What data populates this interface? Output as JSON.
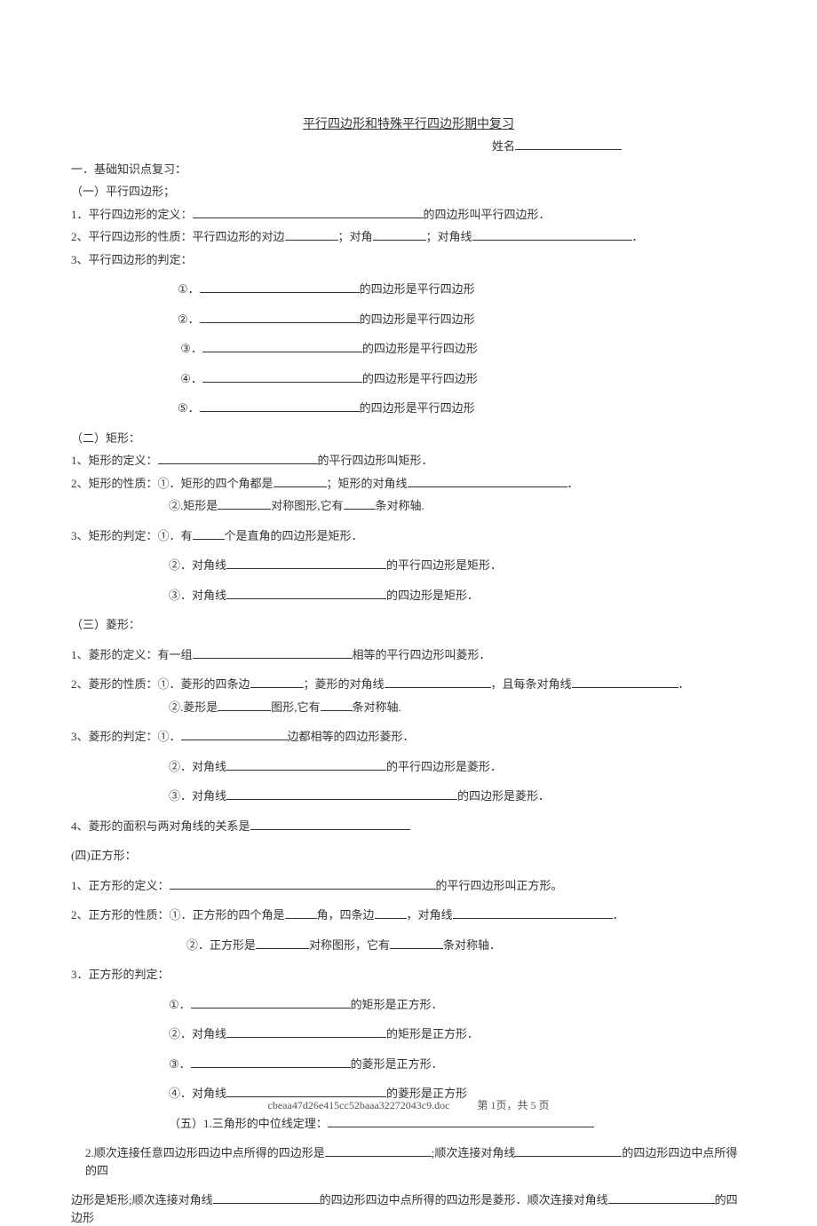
{
  "title": "平行四边形和特殊平行四边形期中复习",
  "name_label": "姓名",
  "s1": {
    "h": "一．基础知识点复习：",
    "sub1": "（一）平行四边形；",
    "l1a": "1．平行四边形的定义：",
    "l1b": "的四边形叫平行四边形．",
    "l2a": "2、平行四边形的性质：平行四边形的对边",
    "l2b": "；对角",
    "l2c": "；对角线",
    "l2d": "．",
    "l3a": "3、平行四边形的判定：",
    "j_suffix": "的四边形是平行四边形",
    "j1": "①．",
    "j2": "②．",
    "j3": "③．",
    "j4": "④．",
    "j5": "⑤．"
  },
  "s2": {
    "sub": "（二）矩形：",
    "l1a": "1、矩形的定义：",
    "l1b": "的平行四边形叫矩形．",
    "l2a": "2、矩形的性质：①．矩形的四个角都是",
    "l2b": "；矩形的对角线",
    "l2c": "．",
    "l2d": "②.矩形是",
    "l2e": "对称图形,它有",
    "l2f": "条对称轴.",
    "l3a": "3、矩形的判定：①．有",
    "l3b": "个是直角的四边形是矩形．",
    "l3c": "②．对角线",
    "l3d": "的平行四边形是矩形．",
    "l3e": "③．对角线",
    "l3f": "的四边形是矩形．"
  },
  "s3": {
    "sub": "（三）菱形：",
    "l1a": "1、菱形的定义：有一组",
    "l1b": "相等的平行四边形叫菱形．",
    "l2a": "2、菱形的性质：①．菱形的四条边",
    "l2b": "；菱形的对角线",
    "l2c": "，且每条对角线",
    "l2d": "．",
    "l2e": "②.菱形是",
    "l2f": "图形,它有",
    "l2g": "条对称轴.",
    "l3a": "3、菱形的判定：①．",
    "l3b": "边都相等的四边形菱形．",
    "l3c": "②．对角线",
    "l3d": "的平行四边形是菱形．",
    "l3e": "③．对角线",
    "l3f": "的四边形是菱形．",
    "l4a": "4、菱形的面积与两对角线的关系是"
  },
  "s4": {
    "sub": "(四)正方形：",
    "l1a": "1、正方形的定义：",
    "l1b": "的平行四边形叫正方形。",
    "l2a": "2、正方形的性质：①．正方形的四个角是",
    "l2b": "角，四条边",
    "l2c": "，对角线",
    "l2d": "．",
    "l2e": "②．正方形是",
    "l2f": "对称图形，它有",
    "l2g": "条对称轴．",
    "l3a": "3．正方形的判定：",
    "j1a": "①．",
    "j1b": "的矩形是正方形．",
    "j2a": "②．对角线",
    "j2b": "的矩形是正方形．",
    "j3a": "③．",
    "j3b": "的菱形是正方形．",
    "j4a": "④．对角线",
    "j4b": "的菱形是正方形"
  },
  "s5": {
    "l1a": "（五）1.三角形的中位线定理：",
    "l2a": "2.顺次连接任意四边形四边中点所得的四边形是",
    "l2b": ";顺次连接对角线",
    "l2c": "的四边形四边中点所得的四",
    "l2d": "边形是矩形;顺次连接对角线",
    "l2e": "的四边形四边中点所得的四边形是菱形．顺次连接对角线",
    "l2f": "的四边形"
  },
  "footer": {
    "filename": "cbeaa47d26e415cc52baaa32272043c9.doc",
    "page": "第 1页，共 5 页"
  }
}
